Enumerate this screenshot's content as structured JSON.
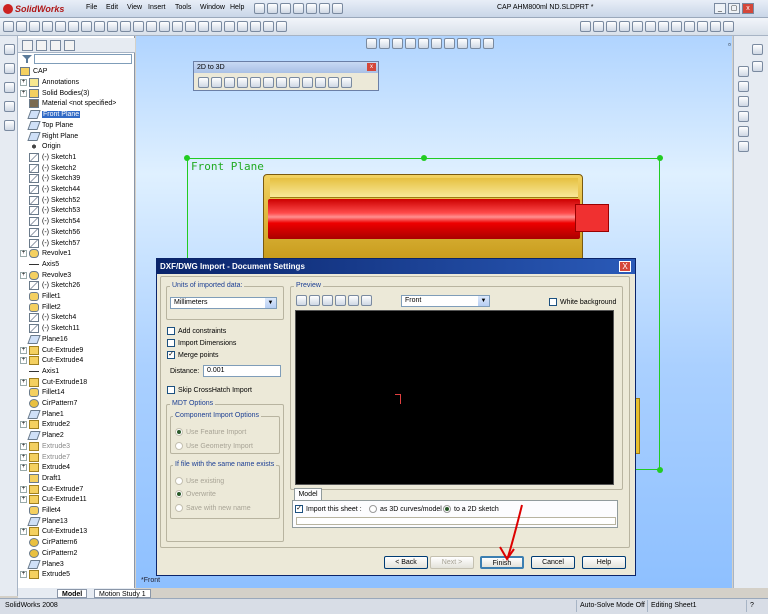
{
  "app": {
    "logo_text": "SolidWorks",
    "menus": [
      "File",
      "Edit",
      "View",
      "Insert",
      "Tools",
      "Window",
      "Help"
    ],
    "document_title": "CAP AHM800ml ND.SLDPRT *"
  },
  "tree": {
    "root": "CAP",
    "items": [
      {
        "label": "Annotations",
        "icon": "annotations-icon",
        "exp": "+",
        "kind": "ann"
      },
      {
        "label": "Solid Bodies(3)",
        "icon": "solid-bodies-icon",
        "exp": "+",
        "kind": "sb"
      },
      {
        "label": "Material <not specified>",
        "icon": "material-icon",
        "exp": "",
        "kind": "mat"
      },
      {
        "label": "Front Plane",
        "icon": "plane-icon",
        "exp": "",
        "kind": "pl",
        "selected": true
      },
      {
        "label": "Top Plane",
        "icon": "plane-icon",
        "exp": "",
        "kind": "pl"
      },
      {
        "label": "Right Plane",
        "icon": "plane-icon",
        "exp": "",
        "kind": "pl"
      },
      {
        "label": "Origin",
        "icon": "origin-icon",
        "exp": "",
        "kind": "org"
      },
      {
        "label": "(-) Sketch1",
        "icon": "sketch-icon",
        "exp": "",
        "kind": "sk"
      },
      {
        "label": "(-) Sketch2",
        "icon": "sketch-icon",
        "exp": "",
        "kind": "sk"
      },
      {
        "label": "(-) Sketch39",
        "icon": "sketch-icon",
        "exp": "",
        "kind": "sk"
      },
      {
        "label": "(-) Sketch44",
        "icon": "sketch-icon",
        "exp": "",
        "kind": "sk"
      },
      {
        "label": "(-) Sketch52",
        "icon": "sketch-icon",
        "exp": "",
        "kind": "sk"
      },
      {
        "label": "(-) Sketch53",
        "icon": "sketch-icon",
        "exp": "",
        "kind": "sk"
      },
      {
        "label": "(-) Sketch54",
        "icon": "sketch-icon",
        "exp": "",
        "kind": "sk"
      },
      {
        "label": "(-) Sketch56",
        "icon": "sketch-icon",
        "exp": "",
        "kind": "sk"
      },
      {
        "label": "(-) Sketch57",
        "icon": "sketch-icon",
        "exp": "",
        "kind": "sk"
      },
      {
        "label": "Revolve1",
        "icon": "revolve-icon",
        "exp": "+",
        "kind": "rev"
      },
      {
        "label": "Axis5",
        "icon": "axis-icon",
        "exp": "",
        "kind": "ax"
      },
      {
        "label": "Revolve3",
        "icon": "revolve-icon",
        "exp": "+",
        "kind": "rev"
      },
      {
        "label": "(-) Sketch26",
        "icon": "sketch-icon",
        "exp": "",
        "kind": "sk"
      },
      {
        "label": "Fillet1",
        "icon": "fillet-icon",
        "exp": "",
        "kind": "fi"
      },
      {
        "label": "Fillet2",
        "icon": "fillet-icon",
        "exp": "",
        "kind": "fi"
      },
      {
        "label": "(-) Sketch4",
        "icon": "sketch-icon",
        "exp": "",
        "kind": "sk"
      },
      {
        "label": "(-) Sketch11",
        "icon": "sketch-icon",
        "exp": "",
        "kind": "sk"
      },
      {
        "label": "Plane16",
        "icon": "plane-icon",
        "exp": "",
        "kind": "pl"
      },
      {
        "label": "Cut-Extrude9",
        "icon": "cut-extrude-icon",
        "exp": "+",
        "kind": "cut"
      },
      {
        "label": "Cut-Extrude4",
        "icon": "cut-extrude-icon",
        "exp": "+",
        "kind": "cut"
      },
      {
        "label": "Axis1",
        "icon": "axis-icon",
        "exp": "",
        "kind": "ax"
      },
      {
        "label": "Cut-Extrude18",
        "icon": "cut-extrude-icon",
        "exp": "+",
        "kind": "cut"
      },
      {
        "label": "Fillet14",
        "icon": "fillet-icon",
        "exp": "",
        "kind": "fi"
      },
      {
        "label": "CirPattern7",
        "icon": "circular-pattern-icon",
        "exp": "",
        "kind": "pat"
      },
      {
        "label": "Plane1",
        "icon": "plane-icon",
        "exp": "",
        "kind": "pl"
      },
      {
        "label": "Extrude2",
        "icon": "extrude-icon",
        "exp": "+",
        "kind": "ex"
      },
      {
        "label": "Plane2",
        "icon": "plane-icon",
        "exp": "",
        "kind": "pl"
      },
      {
        "label": "Extrude3",
        "icon": "extrude-icon",
        "exp": "+",
        "kind": "ex",
        "grey": true
      },
      {
        "label": "Extrude7",
        "icon": "extrude-icon",
        "exp": "+",
        "kind": "ex",
        "grey": true
      },
      {
        "label": "Extrude4",
        "icon": "extrude-icon",
        "exp": "+",
        "kind": "ex"
      },
      {
        "label": "Draft1",
        "icon": "draft-icon",
        "exp": "",
        "kind": "dr"
      },
      {
        "label": "Cut-Extrude7",
        "icon": "cut-extrude-icon",
        "exp": "+",
        "kind": "cut"
      },
      {
        "label": "Cut-Extrude11",
        "icon": "cut-extrude-icon",
        "exp": "+",
        "kind": "cut"
      },
      {
        "label": "Fillet4",
        "icon": "fillet-icon",
        "exp": "",
        "kind": "fi"
      },
      {
        "label": "Plane13",
        "icon": "plane-icon",
        "exp": "",
        "kind": "pl"
      },
      {
        "label": "Cut-Extrude13",
        "icon": "cut-extrude-icon",
        "exp": "+",
        "kind": "cut"
      },
      {
        "label": "CirPattern6",
        "icon": "circular-pattern-icon",
        "exp": "",
        "kind": "pat"
      },
      {
        "label": "CirPattern2",
        "icon": "circular-pattern-icon",
        "exp": "",
        "kind": "pat"
      },
      {
        "label": "Plane3",
        "icon": "plane-icon",
        "exp": "",
        "kind": "pl"
      },
      {
        "label": "Extrude5",
        "icon": "extrude-icon",
        "exp": "+",
        "kind": "ex"
      }
    ]
  },
  "graphics": {
    "plane_label": "Front Plane",
    "view_label": "*Front"
  },
  "toolbar_2d3d": {
    "title": "2D to 3D"
  },
  "dialog": {
    "title": "DXF/DWG Import - Document Settings",
    "close_label": "X",
    "units_group": "Units of imported data:",
    "units_value": "Millimeters",
    "add_constraints": "Add constraints",
    "import_dimensions": "Import Dimensions",
    "merge_points": "Merge points",
    "distance_label": "Distance:",
    "distance_value": "0.001",
    "skip_crosshatch": "Skip CrossHatch Import",
    "mdt_options": "MDT Options",
    "component_import_options": "Component Import Options",
    "use_feature_import": "Use Feature Import",
    "use_geometry_import": "Use Geometry Import",
    "file_exists_group": "If file with the same name exists",
    "use_existing": "Use existing",
    "overwrite": "Overwrite",
    "save_with_new_name": "Save with new name",
    "preview_group": "Preview",
    "view_value": "Front",
    "white_background": "White background",
    "model_tab": "Model",
    "import_this_sheet": "Import this sheet :",
    "as_3d_curves": "as 3D curves/model",
    "to_2d_sketch": "to a 2D sketch",
    "back_button": "< Back",
    "next_button": "Next >",
    "finish_button": "Finish",
    "cancel_button": "Cancel",
    "help_button": "Help"
  },
  "bottom_tabs": [
    "Model",
    "Motion Study 1"
  ],
  "status": {
    "left": "SolidWorks 2008",
    "auto_solve": "Auto-Solve Mode Off",
    "editing": "Editing Sheet1"
  },
  "colors": {
    "cap_body": "#f2d260",
    "red_band": "#e00000",
    "plane_outline": "#22cc22",
    "title_blue": "#0a246a"
  }
}
